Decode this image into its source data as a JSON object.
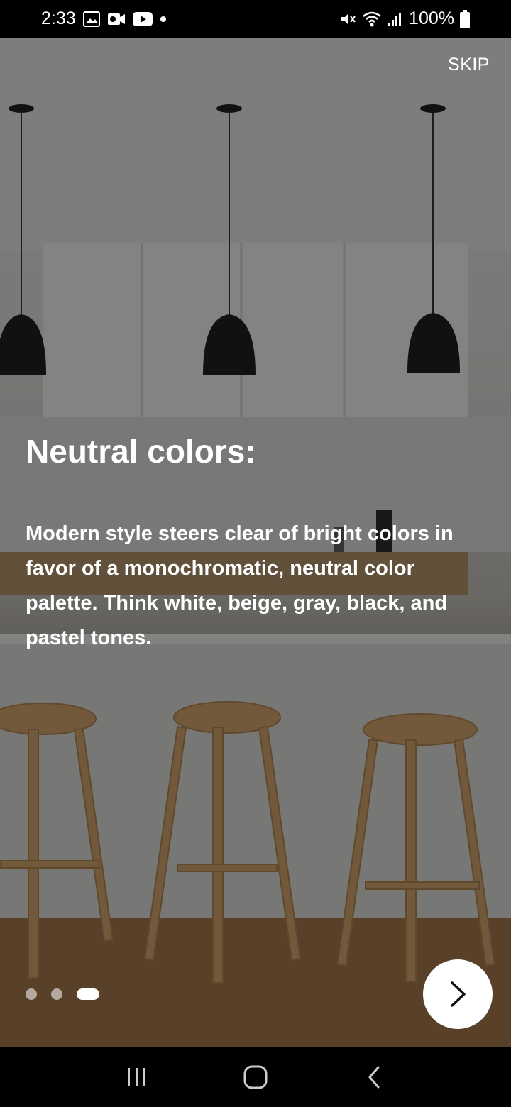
{
  "status_bar": {
    "time": "2:33",
    "battery": "100%",
    "icons_left": [
      "gallery-icon",
      "camera-notification-icon",
      "youtube-icon",
      "dot-icon"
    ],
    "icons_right": [
      "mute-icon",
      "wifi-icon",
      "signal-icon",
      "battery-icon"
    ]
  },
  "onboarding": {
    "skip_label": "SKIP",
    "title": "Neutral colors:",
    "body": "Modern style steers clear of bright colors in favor of a monochromatic, neutral color palette. Think white, beige, gray, black, and pastel tones.",
    "page_count": 3,
    "current_page": 3,
    "next_icon": "chevron-right-icon"
  },
  "nav_bar": {
    "recents_icon": "recents-icon",
    "home_icon": "home-icon",
    "back_icon": "back-icon"
  }
}
